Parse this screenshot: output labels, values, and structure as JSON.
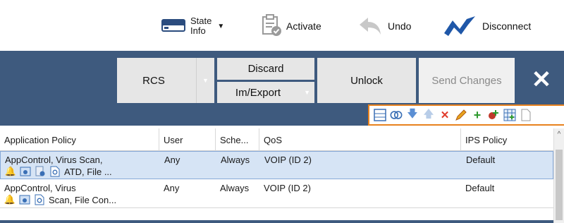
{
  "toolbar": {
    "state_info_line1": "State",
    "state_info_line2": "Info",
    "activate": "Activate",
    "undo": "Undo",
    "disconnect": "Disconnect"
  },
  "panel": {
    "rcs": "RCS",
    "discard": "Discard",
    "im_export": "Im/Export",
    "unlock": "Unlock",
    "send_changes": "Send Changes",
    "close": "✕"
  },
  "iconbar": {
    "icons": [
      "rows-icon",
      "merge-icon",
      "move-down-icon",
      "move-up-icon",
      "delete-icon",
      "edit-icon",
      "add-icon",
      "add-rule-icon",
      "grid-icon",
      "document-icon"
    ]
  },
  "table": {
    "headers": [
      "Application Policy",
      "User",
      "Sche...",
      "QoS",
      "IPS Policy"
    ],
    "rows": [
      {
        "app_line1": "AppControl, Virus Scan,",
        "app_line2": "ATD, File ...",
        "user": "Any",
        "schedule": "Always",
        "qos": "VOIP (ID 2)",
        "ips": "Default",
        "selected": true
      },
      {
        "app_line1": "AppControl, Virus",
        "app_line2": "Scan, File Con...",
        "user": "Any",
        "schedule": "Always",
        "qos": "VOIP (ID 2)",
        "ips": "Default",
        "selected": false
      }
    ]
  },
  "colors": {
    "panel_blue": "#3e5a7e",
    "accent_orange": "#e8821e",
    "selection": "#d6e4f5"
  }
}
